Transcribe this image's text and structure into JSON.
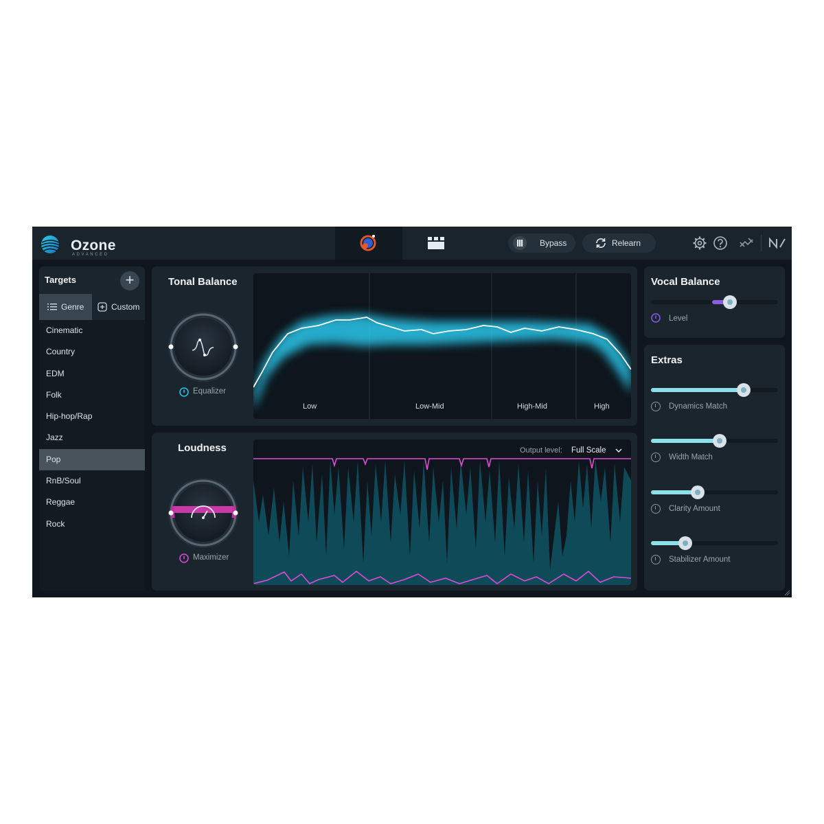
{
  "app": {
    "name": "Ozone",
    "edition": "ADVANCED"
  },
  "header": {
    "bypass_label": "Bypass",
    "relearn_label": "Relearn",
    "icons": [
      "assistant-icon",
      "modules-icon",
      "bypass-icon",
      "relearn-icon",
      "gear-icon",
      "help-icon",
      "route-icon",
      "ni-logo-icon"
    ]
  },
  "targets": {
    "title": "Targets",
    "add_label": "+",
    "tabs": {
      "genre": "Genre",
      "custom": "Custom"
    },
    "items": [
      "Cinematic",
      "Country",
      "EDM",
      "Folk",
      "Hip-hop/Rap",
      "Jazz",
      "Pop",
      "RnB/Soul",
      "Reggae",
      "Rock"
    ],
    "selected": "Pop"
  },
  "tonal_balance": {
    "title": "Tonal Balance",
    "module_label": "Equalizer",
    "bands": [
      "Low",
      "Low-Mid",
      "High-Mid",
      "High"
    ],
    "colors": {
      "band": "#29c6ea",
      "curve": "#ffffff"
    }
  },
  "loudness": {
    "title": "Loudness",
    "module_label": "Maximizer",
    "output_label": "Output level:",
    "output_value": "Full Scale",
    "colors": {
      "waveform": "#0f4a58",
      "limit": "#e04bd8"
    }
  },
  "vocal_balance": {
    "title": "Vocal Balance",
    "level_label": "Level",
    "level_value": 0.62,
    "color": "#8a5ce6"
  },
  "extras": {
    "title": "Extras",
    "sliders": [
      {
        "label": "Dynamics Match",
        "value": 0.73
      },
      {
        "label": "Width Match",
        "value": 0.54
      },
      {
        "label": "Clarity Amount",
        "value": 0.37
      },
      {
        "label": "Stabilizer Amount",
        "value": 0.27
      }
    ],
    "color": "#8ee0e8"
  }
}
